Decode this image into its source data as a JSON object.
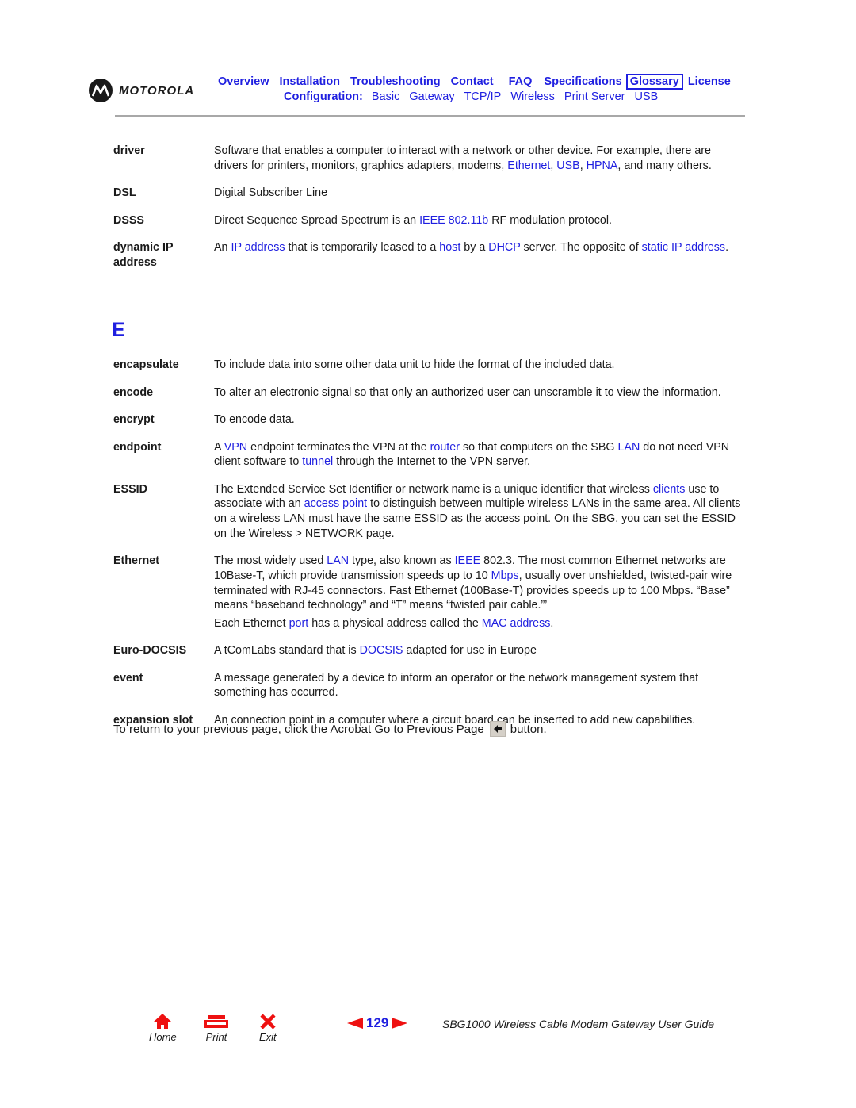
{
  "header": {
    "brand": "MOTOROLA",
    "nav_primary": [
      {
        "label": "Overview",
        "active": false
      },
      {
        "label": "Installation",
        "active": false
      },
      {
        "label": "Troubleshooting",
        "active": false
      },
      {
        "label": "Contact",
        "active": false
      },
      {
        "label": "FAQ",
        "active": false
      },
      {
        "label": "Specifications",
        "active": false
      },
      {
        "label": "Glossary",
        "active": true
      },
      {
        "label": "License",
        "active": false
      }
    ],
    "config_label": "Configuration:",
    "nav_config": [
      "Basic",
      "Gateway",
      "TCP/IP",
      "Wireless",
      "Print Server",
      "USB"
    ]
  },
  "glossary_d": [
    {
      "term": "driver",
      "paragraphs": [
        [
          {
            "t": "Software that enables a computer to interact with a network or other device. For example, there are drivers for printers, monitors, graphics adapters, modems, "
          },
          {
            "t": "Ethernet",
            "link": true
          },
          {
            "t": ", "
          },
          {
            "t": "USB",
            "link": true
          },
          {
            "t": ", "
          },
          {
            "t": "HPNA",
            "link": true
          },
          {
            "t": ", and many others."
          }
        ]
      ]
    },
    {
      "term": "DSL",
      "paragraphs": [
        [
          {
            "t": "Digital Subscriber Line"
          }
        ]
      ]
    },
    {
      "term": "DSSS",
      "paragraphs": [
        [
          {
            "t": "Direct Sequence Spread Spectrum is an "
          },
          {
            "t": "IEEE 802.11b",
            "link": true
          },
          {
            "t": " RF modulation protocol."
          }
        ]
      ]
    },
    {
      "term": "dynamic IP address",
      "paragraphs": [
        [
          {
            "t": "An "
          },
          {
            "t": "IP address",
            "link": true
          },
          {
            "t": " that is temporarily leased to a "
          },
          {
            "t": "host",
            "link": true
          },
          {
            "t": " by a "
          },
          {
            "t": "DHCP",
            "link": true
          },
          {
            "t": " server. The opposite of "
          },
          {
            "t": "static IP address",
            "link": true
          },
          {
            "t": "."
          }
        ]
      ]
    }
  ],
  "section_letter": "E",
  "glossary_e": [
    {
      "term": "encapsulate",
      "paragraphs": [
        [
          {
            "t": "To include data into some other data unit to hide the format of the included data."
          }
        ]
      ]
    },
    {
      "term": "encode",
      "paragraphs": [
        [
          {
            "t": "To alter an electronic signal so that only an authorized user can unscramble it to view the information."
          }
        ]
      ]
    },
    {
      "term": "encrypt",
      "paragraphs": [
        [
          {
            "t": "To encode data."
          }
        ]
      ]
    },
    {
      "term": "endpoint",
      "paragraphs": [
        [
          {
            "t": "A "
          },
          {
            "t": "VPN",
            "link": true
          },
          {
            "t": " endpoint terminates the VPN at the "
          },
          {
            "t": "router",
            "link": true
          },
          {
            "t": " so that computers on the SBG "
          },
          {
            "t": "LAN",
            "link": true
          },
          {
            "t": " do not need VPN client software to "
          },
          {
            "t": "tunnel",
            "link": true
          },
          {
            "t": " through the Internet to the VPN server."
          }
        ]
      ]
    },
    {
      "term": "ESSID",
      "paragraphs": [
        [
          {
            "t": "The Extended Service Set Identifier or network name is a unique identifier that wireless "
          },
          {
            "t": "clients",
            "link": true
          },
          {
            "t": " use to associate with an "
          },
          {
            "t": "access point",
            "link": true
          },
          {
            "t": " to distinguish between multiple wireless LANs in the same area. All clients on a wireless LAN must have the same ESSID as the access point. On the SBG, you can set the ESSID on the Wireless > NETWORK page."
          }
        ]
      ]
    },
    {
      "term": "Ethernet",
      "paragraphs": [
        [
          {
            "t": "The most widely used "
          },
          {
            "t": "LAN",
            "link": true
          },
          {
            "t": " type, also known as "
          },
          {
            "t": "IEEE",
            "link": true
          },
          {
            "t": " 802.3. The most common Ethernet networks are 10Base-T, which provide transmission speeds up to 10 "
          },
          {
            "t": "Mbps",
            "link": true
          },
          {
            "t": ", usually over unshielded, twisted-pair wire terminated with RJ-45 connectors. Fast Ethernet (100Base-T) provides speeds up to 100 Mbps. “Base” means “baseband technology” and “T” means “twisted pair cable.”’"
          }
        ],
        [
          {
            "t": "Each Ethernet "
          },
          {
            "t": "port",
            "link": true
          },
          {
            "t": " has a physical address called the "
          },
          {
            "t": "MAC address",
            "link": true
          },
          {
            "t": "."
          }
        ]
      ]
    },
    {
      "term": "Euro-DOCSIS",
      "paragraphs": [
        [
          {
            "t": "A tComLabs standard that is "
          },
          {
            "t": "DOCSIS",
            "link": true
          },
          {
            "t": " adapted for use in Europe"
          }
        ]
      ]
    },
    {
      "term": "event",
      "paragraphs": [
        [
          {
            "t": "A message generated by a device to inform an operator or the network management system that something has occurred."
          }
        ]
      ]
    },
    {
      "term": "expansion slot",
      "paragraphs": [
        [
          {
            "t": "An connection point in a computer where a circuit board can be inserted to add new capabilities."
          }
        ]
      ]
    }
  ],
  "return_note": {
    "before": "To return to your previous page, click the Acrobat Go to Previous Page",
    "after": "button."
  },
  "footer": {
    "home_label": "Home",
    "print_label": "Print",
    "exit_label": "Exit",
    "page_number": "129",
    "guide_title": "SBG1000 Wireless Cable Modem Gateway User Guide"
  },
  "colors": {
    "link": "#1f1fe0",
    "footer_icon": "#ee1111"
  }
}
